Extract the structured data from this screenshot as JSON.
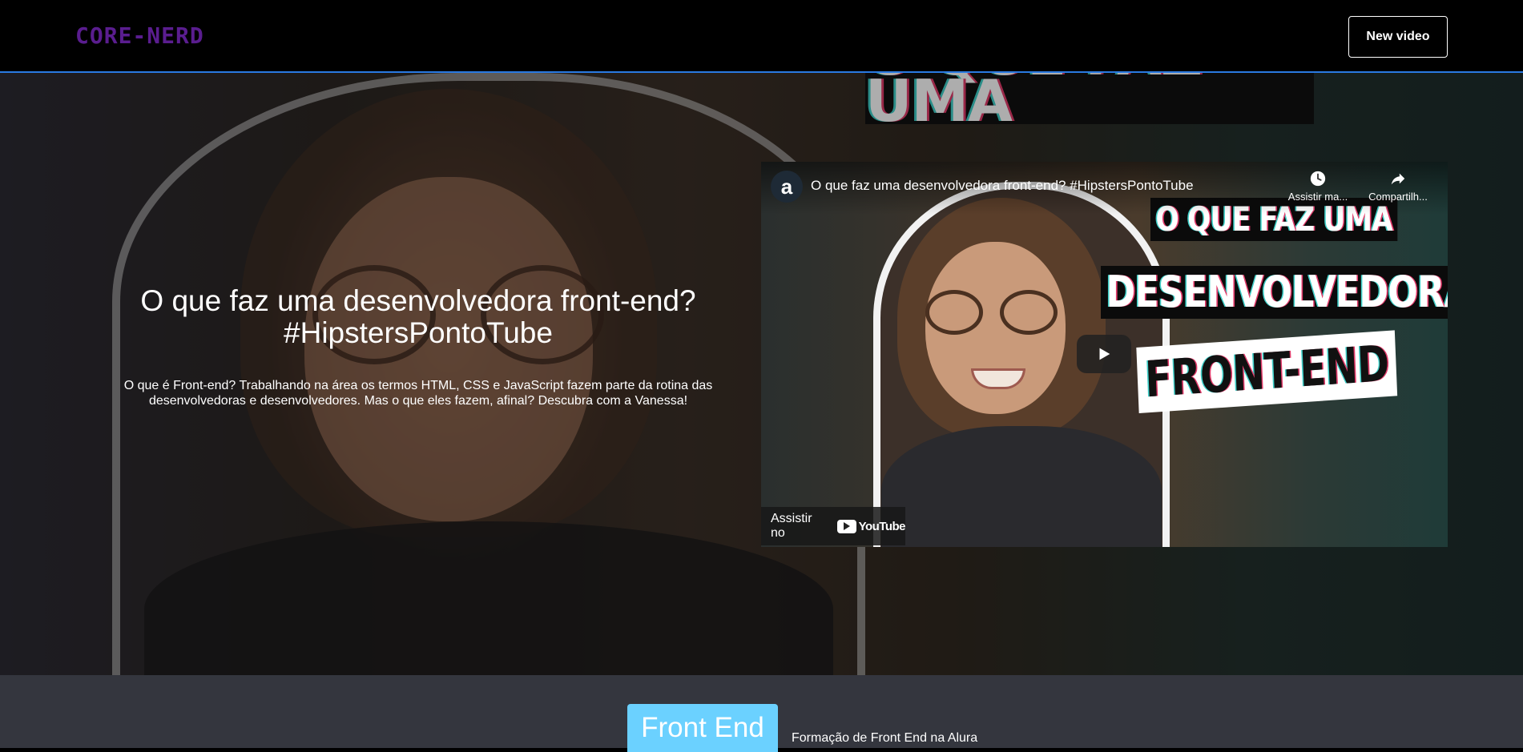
{
  "header": {
    "logo": "CORE-NERD",
    "new_video_label": "New video"
  },
  "banner": {
    "title": "O que faz uma desenvolvedora front-end? #HipstersPontoTube",
    "description": "O que é Front-end? Trabalhando na área os termos HTML, CSS e JavaScript fazem parte da rotina das desenvolvedoras e desenvolvedores. Mas o que eles fazem, afinal? Descubra com a Vanessa!",
    "background_sign_text": "O QUE FAZ UMA"
  },
  "player": {
    "channel_avatar": "a",
    "title": "O que faz uma desenvolvedora front-end? #HipstersPontoTube",
    "watch_later_label": "Assistir ma...",
    "share_label": "Compartilh...",
    "thumbnail_lines": [
      "O QUE FAZ UMA",
      "DESENVOLVEDORA",
      "FRONT-END"
    ],
    "watch_on_label": "Assistir no",
    "youtube_word": "YouTube",
    "icons": {
      "watch_later": "clock-icon",
      "share": "share-arrow-icon",
      "play": "play-icon",
      "youtube": "youtube-logo-icon"
    }
  },
  "category": {
    "name": "Front End",
    "description": "Formação de Front End na Alura",
    "color": "#6bd1ff"
  },
  "colors": {
    "header_bg": "#000000",
    "header_border": "#2a7ae2",
    "logo": "#5a1d8f",
    "bottom_bg": "#34363e"
  }
}
